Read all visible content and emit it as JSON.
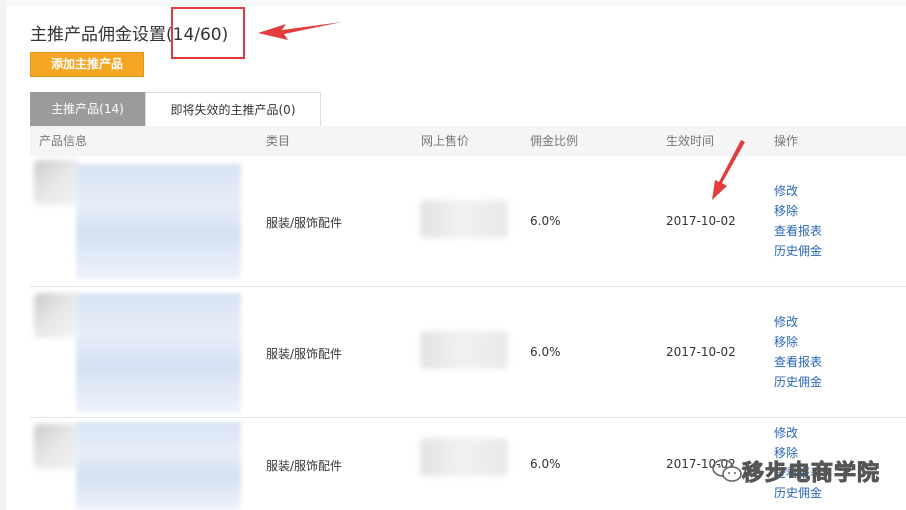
{
  "header": {
    "title": "主推产品佣金设置",
    "count": "(14/60)",
    "add_button": "添加主推产品"
  },
  "tabs": [
    {
      "label": "主推产品(14)",
      "active": true
    },
    {
      "label": "即将失效的主推产品(0)",
      "active": false
    }
  ],
  "table": {
    "columns": [
      "产品信息",
      "类目",
      "网上售价",
      "佣金比例",
      "生效时间",
      "操作"
    ],
    "rows": [
      {
        "category": "服装/服饰配件",
        "commission": "6.0%",
        "date": "2017-10-02",
        "actions": [
          "修改",
          "移除",
          "查看报表",
          "历史佣金"
        ]
      },
      {
        "category": "服装/服饰配件",
        "commission": "6.0%",
        "date": "2017-10-02",
        "actions": [
          "修改",
          "移除",
          "查看报表",
          "历史佣金"
        ]
      },
      {
        "category": "服装/服饰配件",
        "commission": "6.0%",
        "date": "2017-10-02",
        "actions": [
          "修改",
          "移除",
          "查看报表",
          "历史佣金"
        ]
      }
    ]
  },
  "annotation": {
    "color": "#e23c3c"
  },
  "watermark": {
    "text": "移步电商学院",
    "icon": "wechat-icon"
  },
  "colors": {
    "accent": "#f5a623",
    "link": "#2a66b8",
    "tab_active": "#9b9b9b"
  }
}
